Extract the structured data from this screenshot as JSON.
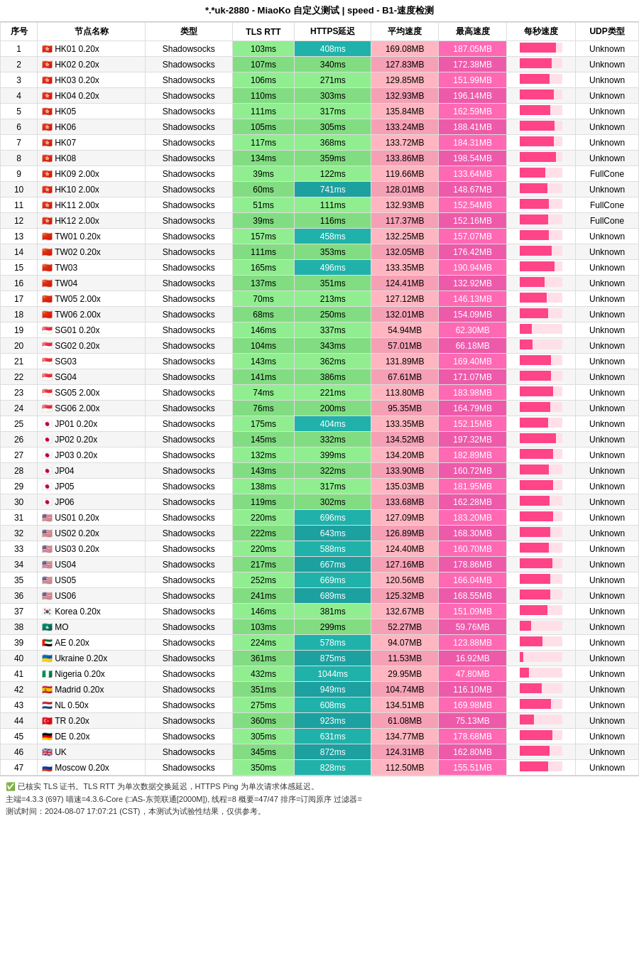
{
  "title": "*.*uk-2880 - MiaoKo 自定义测试 | speed - B1-速度检测",
  "headers": [
    "序号",
    "节点名称",
    "类型",
    "TLS RTT",
    "HTTPS延迟",
    "平均速度",
    "最高速度",
    "每秒速度",
    "UDP类型"
  ],
  "rows": [
    {
      "seq": 1,
      "flag": "🇭🇰",
      "name": "HK01 0.20x",
      "type": "Shadowsocks",
      "tls": "103ms",
      "https": "408ms",
      "httpsHigh": true,
      "avg": "169.08MB",
      "max": "187.05MB",
      "bar": 85,
      "udp": "Unknown"
    },
    {
      "seq": 2,
      "flag": "🇭🇰",
      "name": "HK02 0.20x",
      "type": "Shadowsocks",
      "tls": "107ms",
      "https": "340ms",
      "httpsHigh": false,
      "avg": "127.83MB",
      "max": "172.38MB",
      "bar": 75,
      "udp": "Unknown"
    },
    {
      "seq": 3,
      "flag": "🇭🇰",
      "name": "HK03 0.20x",
      "type": "Shadowsocks",
      "tls": "106ms",
      "https": "271ms",
      "httpsHigh": false,
      "avg": "129.85MB",
      "max": "151.99MB",
      "bar": 70,
      "udp": "Unknown"
    },
    {
      "seq": 4,
      "flag": "🇭🇰",
      "name": "HK04 0.20x",
      "type": "Shadowsocks",
      "tls": "110ms",
      "https": "303ms",
      "httpsHigh": false,
      "avg": "132.93MB",
      "max": "196.14MB",
      "bar": 80,
      "udp": "Unknown"
    },
    {
      "seq": 5,
      "flag": "🇭🇰",
      "name": "HK05",
      "type": "Shadowsocks",
      "tls": "111ms",
      "https": "317ms",
      "httpsHigh": false,
      "avg": "135.84MB",
      "max": "162.59MB",
      "bar": 72,
      "udp": "Unknown"
    },
    {
      "seq": 6,
      "flag": "🇭🇰",
      "name": "HK06",
      "type": "Shadowsocks",
      "tls": "105ms",
      "https": "305ms",
      "httpsHigh": false,
      "avg": "133.24MB",
      "max": "188.41MB",
      "bar": 82,
      "udp": "Unknown"
    },
    {
      "seq": 7,
      "flag": "🇭🇰",
      "name": "HK07",
      "type": "Shadowsocks",
      "tls": "117ms",
      "https": "368ms",
      "httpsHigh": false,
      "avg": "133.72MB",
      "max": "184.31MB",
      "bar": 80,
      "udp": "Unknown"
    },
    {
      "seq": 8,
      "flag": "🇭🇰",
      "name": "HK08",
      "type": "Shadowsocks",
      "tls": "134ms",
      "https": "359ms",
      "httpsHigh": false,
      "avg": "133.86MB",
      "max": "198.54MB",
      "bar": 85,
      "udp": "Unknown"
    },
    {
      "seq": 9,
      "flag": "🇭🇰",
      "name": "HK09 2.00x",
      "type": "Shadowsocks",
      "tls": "39ms",
      "https": "122ms",
      "httpsHigh": false,
      "avg": "119.66MB",
      "max": "133.64MB",
      "bar": 60,
      "udp": "FullCone"
    },
    {
      "seq": 10,
      "flag": "🇭🇰",
      "name": "HK10 2.00x",
      "type": "Shadowsocks",
      "tls": "60ms",
      "https": "741ms",
      "httpsHigh": true,
      "avg": "128.01MB",
      "max": "148.67MB",
      "bar": 65,
      "udp": "Unknown"
    },
    {
      "seq": 11,
      "flag": "🇭🇰",
      "name": "HK11 2.00x",
      "type": "Shadowsocks",
      "tls": "51ms",
      "https": "111ms",
      "httpsHigh": false,
      "avg": "132.93MB",
      "max": "152.54MB",
      "bar": 68,
      "udp": "FullCone"
    },
    {
      "seq": 12,
      "flag": "🇭🇰",
      "name": "HK12 2.00x",
      "type": "Shadowsocks",
      "tls": "39ms",
      "https": "116ms",
      "httpsHigh": false,
      "avg": "117.37MB",
      "max": "152.16MB",
      "bar": 66,
      "udp": "FullCone"
    },
    {
      "seq": 13,
      "flag": "🇨🇳",
      "name": "TW01 0.20x",
      "type": "Shadowsocks",
      "tls": "157ms",
      "https": "458ms",
      "httpsHigh": true,
      "avg": "132.25MB",
      "max": "157.07MB",
      "bar": 68,
      "udp": "Unknown"
    },
    {
      "seq": 14,
      "flag": "🇨🇳",
      "name": "TW02 0.20x",
      "type": "Shadowsocks",
      "tls": "111ms",
      "https": "353ms",
      "httpsHigh": false,
      "avg": "132.05MB",
      "max": "176.42MB",
      "bar": 75,
      "udp": "Unknown"
    },
    {
      "seq": 15,
      "flag": "🇨🇳",
      "name": "TW03",
      "type": "Shadowsocks",
      "tls": "165ms",
      "https": "496ms",
      "httpsHigh": true,
      "avg": "133.35MB",
      "max": "190.94MB",
      "bar": 82,
      "udp": "Unknown"
    },
    {
      "seq": 16,
      "flag": "🇨🇳",
      "name": "TW04",
      "type": "Shadowsocks",
      "tls": "137ms",
      "https": "351ms",
      "httpsHigh": false,
      "avg": "124.41MB",
      "max": "132.92MB",
      "bar": 58,
      "udp": "Unknown"
    },
    {
      "seq": 17,
      "flag": "🇨🇳",
      "name": "TW05 2.00x",
      "type": "Shadowsocks",
      "tls": "70ms",
      "https": "213ms",
      "httpsHigh": false,
      "avg": "127.12MB",
      "max": "146.13MB",
      "bar": 63,
      "udp": "Unknown"
    },
    {
      "seq": 18,
      "flag": "🇨🇳",
      "name": "TW06 2.00x",
      "type": "Shadowsocks",
      "tls": "68ms",
      "https": "250ms",
      "httpsHigh": false,
      "avg": "132.01MB",
      "max": "154.09MB",
      "bar": 67,
      "udp": "Unknown"
    },
    {
      "seq": 19,
      "flag": "🇸🇬",
      "name": "SG01 0.20x",
      "type": "Shadowsocks",
      "tls": "146ms",
      "https": "337ms",
      "httpsHigh": false,
      "avg": "54.94MB",
      "max": "62.30MB",
      "bar": 28,
      "udp": "Unknown"
    },
    {
      "seq": 20,
      "flag": "🇸🇬",
      "name": "SG02 0.20x",
      "type": "Shadowsocks",
      "tls": "104ms",
      "https": "343ms",
      "httpsHigh": false,
      "avg": "57.01MB",
      "max": "66.18MB",
      "bar": 30,
      "udp": "Unknown"
    },
    {
      "seq": 21,
      "flag": "🇸🇬",
      "name": "SG03",
      "type": "Shadowsocks",
      "tls": "143ms",
      "https": "362ms",
      "httpsHigh": false,
      "avg": "131.89MB",
      "max": "169.40MB",
      "bar": 73,
      "udp": "Unknown"
    },
    {
      "seq": 22,
      "flag": "🇸🇬",
      "name": "SG04",
      "type": "Shadowsocks",
      "tls": "141ms",
      "https": "386ms",
      "httpsHigh": false,
      "avg": "67.61MB",
      "max": "171.07MB",
      "bar": 74,
      "udp": "Unknown"
    },
    {
      "seq": 23,
      "flag": "🇸🇬",
      "name": "SG05 2.00x",
      "type": "Shadowsocks",
      "tls": "74ms",
      "https": "221ms",
      "httpsHigh": false,
      "avg": "113.80MB",
      "max": "183.98MB",
      "bar": 79,
      "udp": "Unknown"
    },
    {
      "seq": 24,
      "flag": "🇸🇬",
      "name": "SG06 2.00x",
      "type": "Shadowsocks",
      "tls": "76ms",
      "https": "200ms",
      "httpsHigh": false,
      "avg": "95.35MB",
      "max": "164.79MB",
      "bar": 71,
      "udp": "Unknown"
    },
    {
      "seq": 25,
      "flag": "🇯🇵",
      "name": "JP01 0.20x",
      "type": "Shadowsocks",
      "tls": "175ms",
      "https": "404ms",
      "httpsHigh": true,
      "avg": "133.35MB",
      "max": "152.15MB",
      "bar": 66,
      "udp": "Unknown"
    },
    {
      "seq": 26,
      "flag": "🇯🇵",
      "name": "JP02 0.20x",
      "type": "Shadowsocks",
      "tls": "145ms",
      "https": "332ms",
      "httpsHigh": false,
      "avg": "134.52MB",
      "max": "197.32MB",
      "bar": 85,
      "udp": "Unknown"
    },
    {
      "seq": 27,
      "flag": "🇯🇵",
      "name": "JP03 0.20x",
      "type": "Shadowsocks",
      "tls": "132ms",
      "https": "399ms",
      "httpsHigh": false,
      "avg": "134.20MB",
      "max": "182.89MB",
      "bar": 79,
      "udp": "Unknown"
    },
    {
      "seq": 28,
      "flag": "🇯🇵",
      "name": "JP04",
      "type": "Shadowsocks",
      "tls": "143ms",
      "https": "322ms",
      "httpsHigh": false,
      "avg": "133.90MB",
      "max": "160.72MB",
      "bar": 69,
      "udp": "Unknown"
    },
    {
      "seq": 29,
      "flag": "🇯🇵",
      "name": "JP05",
      "type": "Shadowsocks",
      "tls": "138ms",
      "https": "317ms",
      "httpsHigh": false,
      "avg": "135.03MB",
      "max": "181.95MB",
      "bar": 78,
      "udp": "Unknown"
    },
    {
      "seq": 30,
      "flag": "🇯🇵",
      "name": "JP06",
      "type": "Shadowsocks",
      "tls": "119ms",
      "https": "302ms",
      "httpsHigh": false,
      "avg": "133.68MB",
      "max": "162.28MB",
      "bar": 70,
      "udp": "Unknown"
    },
    {
      "seq": 31,
      "flag": "🇺🇸",
      "name": "US01 0.20x",
      "type": "Shadowsocks",
      "tls": "220ms",
      "https": "696ms",
      "httpsHigh": true,
      "avg": "127.09MB",
      "max": "183.20MB",
      "bar": 79,
      "udp": "Unknown"
    },
    {
      "seq": 32,
      "flag": "🇺🇸",
      "name": "US02 0.20x",
      "type": "Shadowsocks",
      "tls": "222ms",
      "https": "643ms",
      "httpsHigh": true,
      "avg": "126.89MB",
      "max": "168.30MB",
      "bar": 72,
      "udp": "Unknown"
    },
    {
      "seq": 33,
      "flag": "🇺🇸",
      "name": "US03 0.20x",
      "type": "Shadowsocks",
      "tls": "220ms",
      "https": "588ms",
      "httpsHigh": true,
      "avg": "124.40MB",
      "max": "160.70MB",
      "bar": 69,
      "udp": "Unknown"
    },
    {
      "seq": 34,
      "flag": "🇺🇸",
      "name": "US04",
      "type": "Shadowsocks",
      "tls": "217ms",
      "https": "667ms",
      "httpsHigh": true,
      "avg": "127.16MB",
      "max": "178.86MB",
      "bar": 77,
      "udp": "Unknown"
    },
    {
      "seq": 35,
      "flag": "🇺🇸",
      "name": "US05",
      "type": "Shadowsocks",
      "tls": "252ms",
      "https": "669ms",
      "httpsHigh": true,
      "avg": "120.56MB",
      "max": "166.04MB",
      "bar": 71,
      "udp": "Unknown"
    },
    {
      "seq": 36,
      "flag": "🇺🇸",
      "name": "US06",
      "type": "Shadowsocks",
      "tls": "241ms",
      "https": "689ms",
      "httpsHigh": true,
      "avg": "125.32MB",
      "max": "168.55MB",
      "bar": 72,
      "udp": "Unknown"
    },
    {
      "seq": 37,
      "flag": "🇰🇷",
      "name": "Korea 0.20x",
      "type": "Shadowsocks",
      "tls": "146ms",
      "https": "381ms",
      "httpsHigh": false,
      "avg": "132.67MB",
      "max": "151.09MB",
      "bar": 65,
      "udp": "Unknown"
    },
    {
      "seq": 38,
      "flag": "🇲🇴",
      "name": "MO",
      "type": "Shadowsocks",
      "tls": "103ms",
      "https": "299ms",
      "httpsHigh": false,
      "avg": "52.27MB",
      "max": "59.76MB",
      "bar": 26,
      "udp": "Unknown"
    },
    {
      "seq": 39,
      "flag": "🇦🇪",
      "name": "AE 0.20x",
      "type": "Shadowsocks",
      "tls": "224ms",
      "https": "578ms",
      "httpsHigh": true,
      "avg": "94.07MB",
      "max": "123.88MB",
      "bar": 54,
      "udp": "Unknown"
    },
    {
      "seq": 40,
      "flag": "🇺🇦",
      "name": "Ukraine 0.20x",
      "type": "Shadowsocks",
      "tls": "361ms",
      "https": "875ms",
      "httpsHigh": true,
      "avg": "11.53MB",
      "max": "16.92MB",
      "bar": 8,
      "udp": "Unknown"
    },
    {
      "seq": 41,
      "flag": "🇳🇬",
      "name": "Nigeria 0.20x",
      "type": "Shadowsocks",
      "tls": "432ms",
      "https": "1044ms",
      "httpsHigh": true,
      "avg": "29.95MB",
      "max": "47.80MB",
      "bar": 21,
      "udp": "Unknown"
    },
    {
      "seq": 42,
      "flag": "🇪🇸",
      "name": "Madrid 0.20x",
      "type": "Shadowsocks",
      "tls": "351ms",
      "https": "949ms",
      "httpsHigh": true,
      "avg": "104.74MB",
      "max": "116.10MB",
      "bar": 51,
      "udp": "Unknown"
    },
    {
      "seq": 43,
      "flag": "🇳🇱",
      "name": "NL 0.50x",
      "type": "Shadowsocks",
      "tls": "275ms",
      "https": "608ms",
      "httpsHigh": true,
      "avg": "134.51MB",
      "max": "169.98MB",
      "bar": 73,
      "udp": "Unknown"
    },
    {
      "seq": 44,
      "flag": "🇹🇷",
      "name": "TR 0.20x",
      "type": "Shadowsocks",
      "tls": "360ms",
      "https": "923ms",
      "httpsHigh": true,
      "avg": "61.08MB",
      "max": "75.13MB",
      "bar": 33,
      "udp": "Unknown"
    },
    {
      "seq": 45,
      "flag": "🇩🇪",
      "name": "DE 0.20x",
      "type": "Shadowsocks",
      "tls": "305ms",
      "https": "631ms",
      "httpsHigh": true,
      "avg": "134.77MB",
      "max": "178.68MB",
      "bar": 77,
      "udp": "Unknown"
    },
    {
      "seq": 46,
      "flag": "🇬🇧",
      "name": "UK",
      "type": "Shadowsocks",
      "tls": "345ms",
      "https": "872ms",
      "httpsHigh": true,
      "avg": "124.31MB",
      "max": "162.80MB",
      "bar": 70,
      "udp": "Unknown"
    },
    {
      "seq": 47,
      "flag": "🇷🇺",
      "name": "Moscow 0.20x",
      "type": "Shadowsocks",
      "tls": "350ms",
      "https": "828ms",
      "httpsHigh": true,
      "avg": "112.50MB",
      "max": "155.51MB",
      "bar": 67,
      "udp": "Unknown"
    }
  ],
  "footer": {
    "line1": "✅ 已核实 TLS 证书。TLS RTT 为单次数据交换延迟，HTTPS Ping 为单次请求体感延迟。",
    "line2": "主端=4.3.3 (697) 喵速=4.3.6-Core (□AS-东莞联通[2000M]), 线程=8 概要=47/47 排序=订阅原序 过滤器=",
    "line3": "测试时间：2024-08-07 17:07:21 (CST)，本测试为试验性结果，仅供参考。"
  }
}
